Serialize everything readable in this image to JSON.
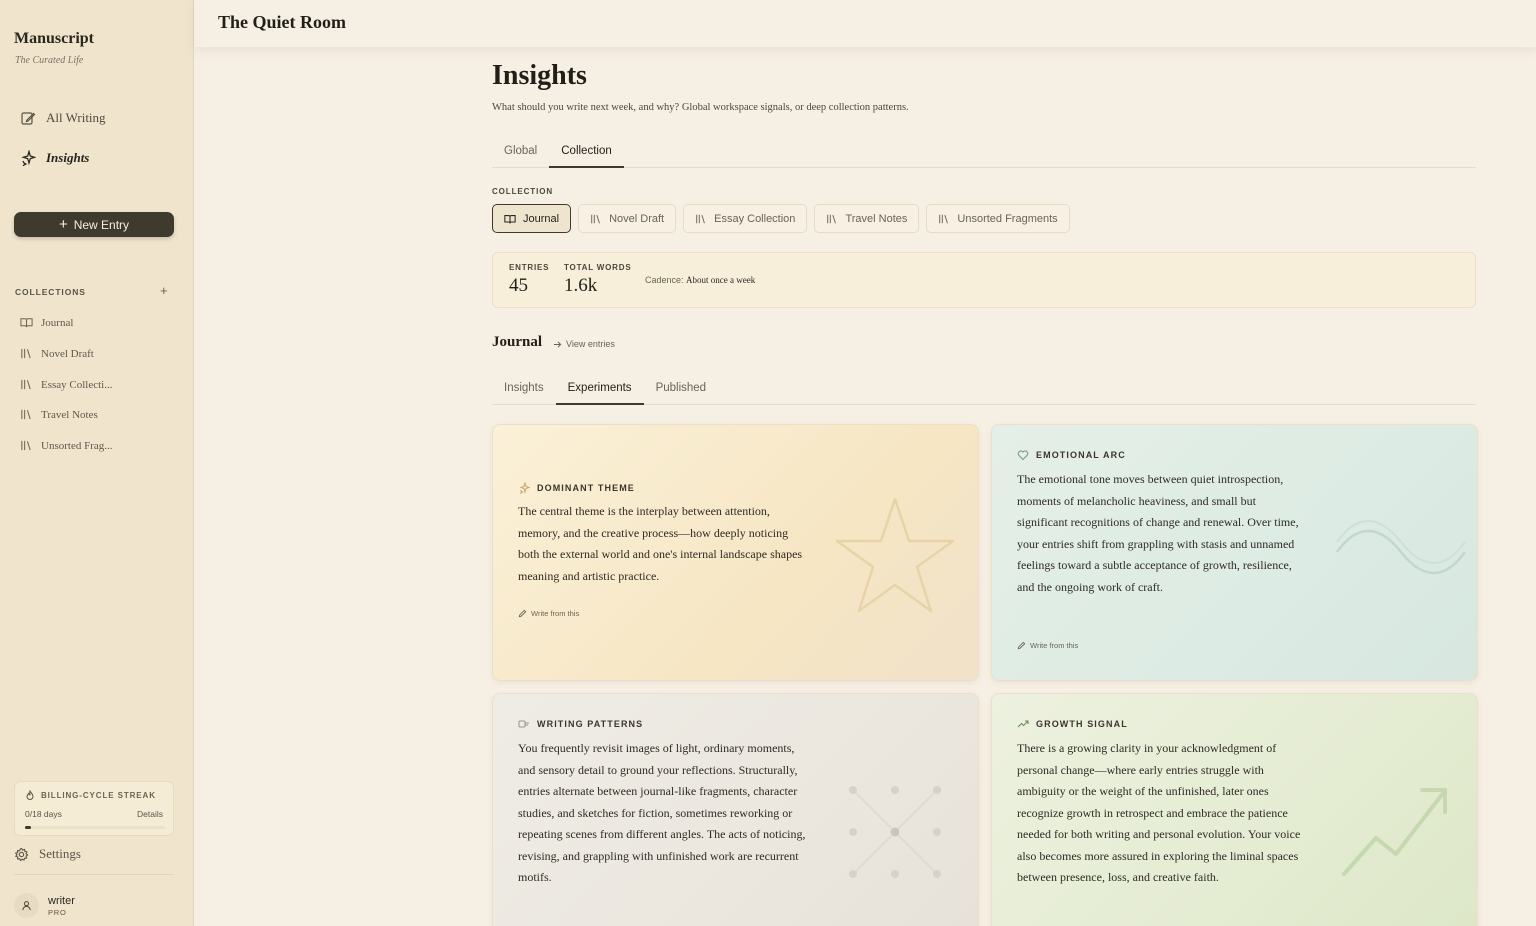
{
  "sidebar": {
    "brand": "Manuscript",
    "tagline": "The Curated Life",
    "nav": [
      {
        "label": "All Writing",
        "icon": "edit-icon"
      },
      {
        "label": "Insights",
        "icon": "sparkle-icon"
      }
    ],
    "new_entry_label": "New Entry",
    "collections_label": "COLLECTIONS",
    "collections": [
      {
        "label": "Journal",
        "icon": "book-icon"
      },
      {
        "label": "Novel Draft",
        "icon": "library-icon"
      },
      {
        "label": "Essay Collecti...",
        "icon": "library-icon"
      },
      {
        "label": "Travel Notes",
        "icon": "library-icon"
      },
      {
        "label": "Unsorted Frag...",
        "icon": "library-icon"
      }
    ],
    "streak": {
      "title": "BILLING-CYCLE STREAK",
      "days": "0/18 days",
      "details": "Details",
      "progress": 0.04
    },
    "settings_label": "Settings",
    "user": {
      "name": "writer",
      "plan": "PRO"
    }
  },
  "header": {
    "title": "The Quiet Room"
  },
  "main": {
    "title": "Insights",
    "subtitle": "What should you write next week, and why? Global workspace signals, or deep collection patterns.",
    "tabs": [
      {
        "label": "Global",
        "active": false
      },
      {
        "label": "Collection",
        "active": true
      }
    ],
    "collection_label": "COLLECTION",
    "chips": [
      {
        "label": "Journal",
        "icon": "book-icon",
        "active": true
      },
      {
        "label": "Novel Draft",
        "icon": "library-icon",
        "active": false
      },
      {
        "label": "Essay Collection",
        "icon": "library-icon",
        "active": false
      },
      {
        "label": "Travel Notes",
        "icon": "library-icon",
        "active": false
      },
      {
        "label": "Unsorted Fragments",
        "icon": "library-icon",
        "active": false
      }
    ],
    "stats": {
      "entries_label": "ENTRIES",
      "entries_value": "45",
      "words_label": "TOTAL WORDS",
      "words_value": "1.6k",
      "cadence_label": "Cadence:",
      "cadence_value": "About once a week"
    },
    "journal_title": "Journal",
    "view_entries": "View entries",
    "subtabs": [
      {
        "label": "Insights",
        "active": false
      },
      {
        "label": "Experiments",
        "active": true
      },
      {
        "label": "Published",
        "active": false
      }
    ],
    "cards": [
      {
        "title": "DOMINANT THEME",
        "icon": "sparkle-icon",
        "body": "The central theme is the interplay between attention, memory, and the creative process—how deeply noticing both the external world and one's internal landscape shapes meaning and artistic practice.",
        "action": "Write from this",
        "color": "#f6e6c4"
      },
      {
        "title": "EMOTIONAL ARC",
        "icon": "heart-icon",
        "body": "The emotional tone moves between quiet introspection, moments of melancholic heaviness, and small but significant recognitions of change and renewal. Over time, your entries shift from grappling with stasis and unnamed feelings toward a subtle acceptance of growth, resilience, and the ongoing work of craft.",
        "action": "Write from this",
        "color": "#dcebe3"
      },
      {
        "title": "WRITING PATTERNS",
        "icon": "pattern-icon",
        "body": "You frequently revisit images of light, ordinary moments, and sensory detail to ground your reflections. Structurally, entries alternate between journal-like fragments, character studies, and sketches for fiction, sometimes reworking or repeating scenes from different angles. The acts of noticing, revising, and grappling with unfinished work are recurrent motifs.",
        "color": "#ebe7df"
      },
      {
        "title": "GROWTH SIGNAL",
        "icon": "trending-up-icon",
        "body": "There is a growing clarity in your acknowledgment of personal change—where early entries struggle with ambiguity or the weight of the unfinished, later ones recognize growth in retrospect and embrace the patience needed for both writing and personal evolution. Your voice also becomes more assured in exploring the liminal spaces between presence, loss, and creative faith.",
        "color": "#e4ecd2"
      }
    ]
  }
}
